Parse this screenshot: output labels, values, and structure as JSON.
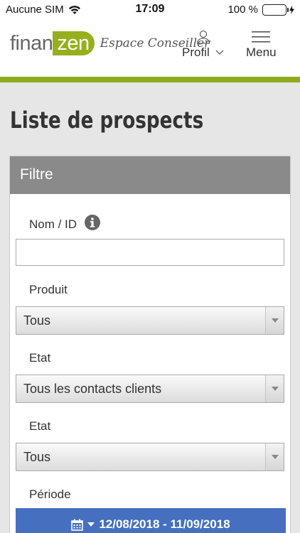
{
  "status_bar": {
    "carrier": "Aucune SIM",
    "time": "17:09",
    "battery_percent": "100 %",
    "battery_level": 1.0
  },
  "header": {
    "logo_finan": "finan",
    "logo_zen": "zen",
    "logo_tagline": "Espace Conseiller",
    "profile_label": "Profil",
    "menu_label": "Menu",
    "accent_color": "#8fac1e"
  },
  "page": {
    "title": "Liste de prospects"
  },
  "filter": {
    "header": "Filtre",
    "name_label": "Nom / ID",
    "name_value": "",
    "product_label": "Produit",
    "product_value": "Tous",
    "state1_label": "Etat",
    "state1_value": "Tous les contacts clients",
    "state2_label": "Etat",
    "state2_value": "Tous",
    "period_label": "Période",
    "period_value": "12/08/2018 - 11/09/2018",
    "period_button_color": "#4670bf"
  }
}
